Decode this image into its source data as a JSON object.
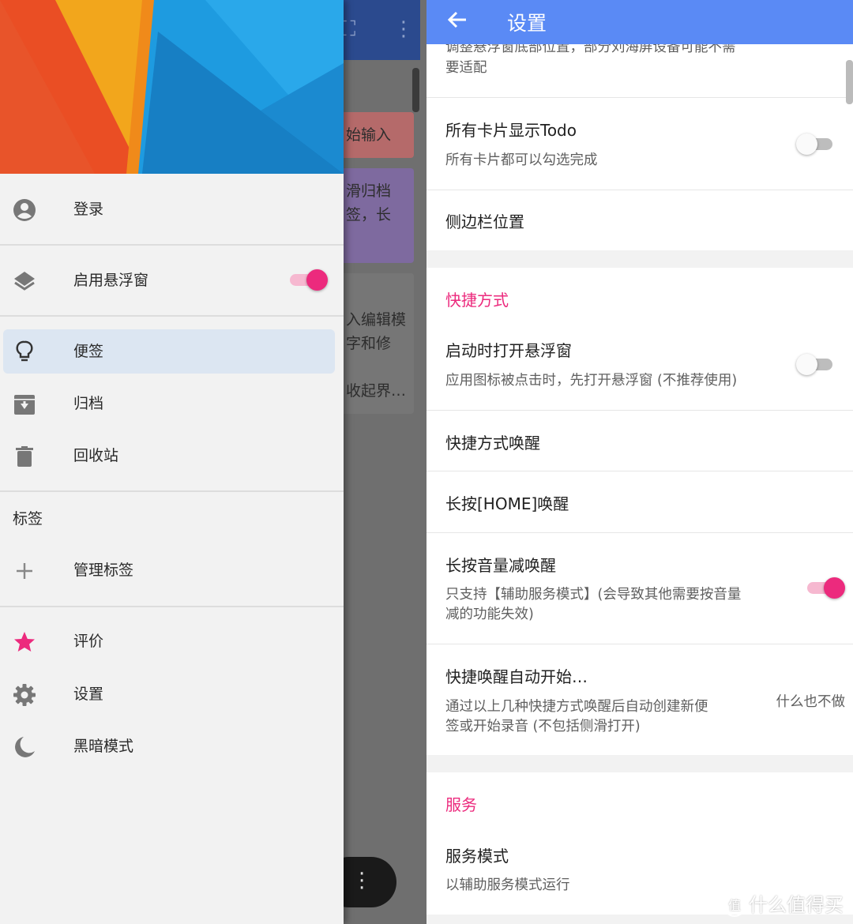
{
  "drawer": {
    "login": "登录",
    "floating_window": "启用悬浮窗",
    "notes": "便签",
    "archive": "归档",
    "trash": "回收站",
    "tags_section": "标签",
    "manage_tags": "管理标签",
    "rate": "评价",
    "settings": "设置",
    "dark_mode": "黑暗模式",
    "floating_window_enabled": true
  },
  "background_app": {
    "card1": "始输入",
    "card2_line1": "滑归档",
    "card2_line2": "签，长",
    "card3_line1": "入编辑模",
    "card3_line2": "字和修",
    "card3_line3": "收起界…"
  },
  "settings": {
    "title": "设置",
    "partial_summary_line1": "调整悬浮窗底部位置，部分刘海屏设备可能不需",
    "partial_summary_line2": "要适配",
    "all_cards_todo": {
      "title": "所有卡片显示Todo",
      "summary": "所有卡片都可以勾选完成",
      "enabled": false
    },
    "sidebar_position": {
      "title": "侧边栏位置"
    },
    "shortcuts_category": "快捷方式",
    "open_on_launch": {
      "title": "启动时打开悬浮窗",
      "summary": "应用图标被点击时，先打开悬浮窗 (不推荐使用)",
      "enabled": false
    },
    "shortcut_wake": {
      "title": "快捷方式唤醒"
    },
    "long_press_home": {
      "title": "长按[HOME]唤醒"
    },
    "volume_down_wake": {
      "title": "长按音量减唤醒",
      "summary_line1": "只支持【辅助服务模式】(会导致其他需要按音量",
      "summary_line2": "减的功能失效)",
      "enabled": true
    },
    "auto_start": {
      "title": "快捷唤醒自动开始…",
      "summary_line1": "通过以上几种快捷方式唤醒后自动创建新便",
      "summary_line2": "签或开始录音 (不包括侧滑打开)",
      "value": "什么也不做"
    },
    "service_category": "服务",
    "service_mode": {
      "title": "服务模式",
      "summary": "以辅助服务模式运行"
    }
  },
  "watermark": {
    "badge": "值",
    "text": "什么值得买"
  },
  "colors": {
    "accent": "#ec2a7d",
    "appbar": "#5a8af5",
    "drawer_active": "#dce6f2"
  }
}
